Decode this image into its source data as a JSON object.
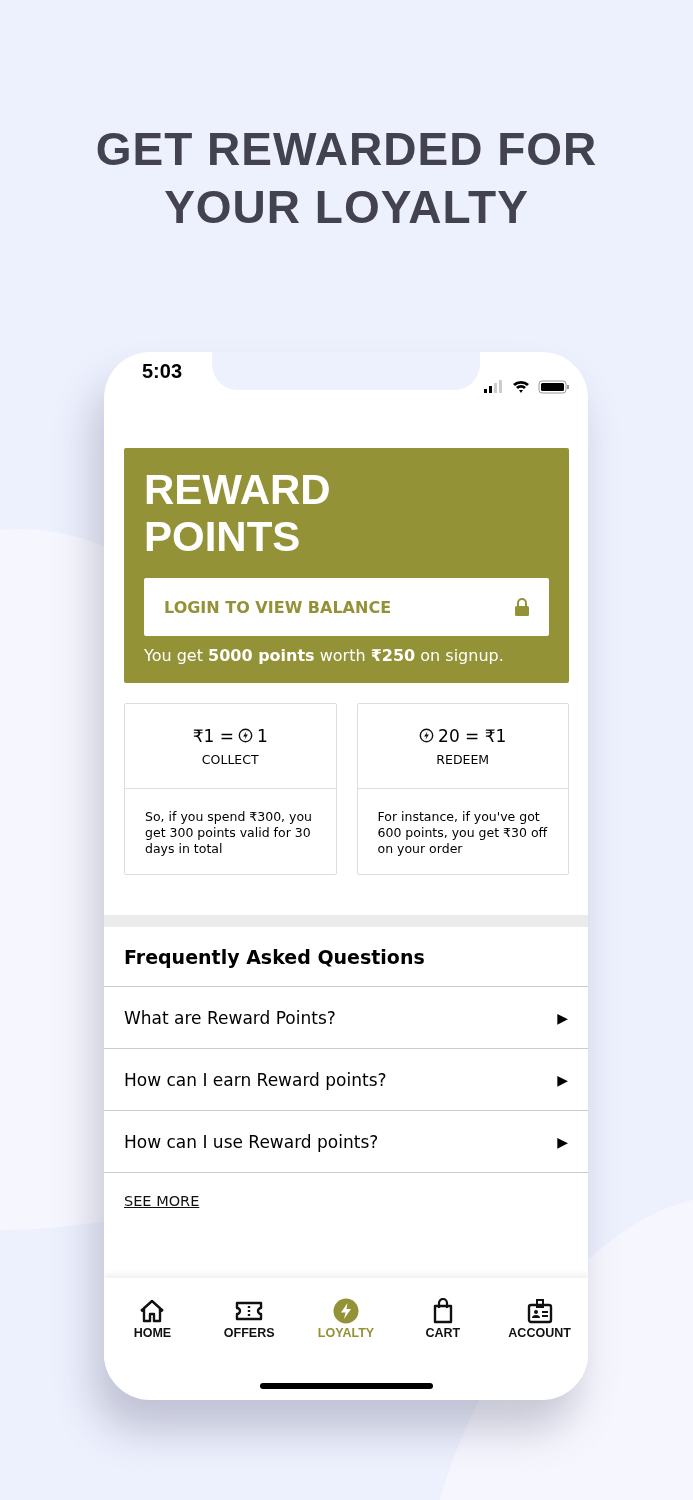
{
  "headline": "GET REWARDED FOR YOUR LOYALTY",
  "status_bar": {
    "time": "5:03"
  },
  "reward_card": {
    "title": "REWARD POINTS",
    "login_button": "LOGIN TO VIEW BALANCE",
    "signup_note": "You get **5000 points** worth **₹250** on signup."
  },
  "rate_cards": [
    {
      "before": "₹1 =",
      "after": "1",
      "label": "COLLECT",
      "description": "So, if you spend ₹300, you get 300 points valid for 30 days in total"
    },
    {
      "after": "20 = ₹1",
      "label": "REDEEM",
      "description": "For instance, if you've got 600 points, you get ₹30 off on your order"
    }
  ],
  "faq": {
    "title": "Frequently Asked Questions",
    "items": [
      {
        "question": "What are Reward Points?",
        "arrow": "▶"
      },
      {
        "question": "How can I earn Reward points?",
        "arrow": "▶"
      },
      {
        "question": "How can I use Reward points?",
        "arrow": "▶"
      }
    ],
    "see_more": "SEE MORE"
  },
  "nav": [
    {
      "label": "HOME",
      "kind": "home",
      "selected": false
    },
    {
      "label": "OFFERS",
      "kind": "offers",
      "selected": false
    },
    {
      "label": "LOYALTY",
      "kind": "loyalty",
      "selected": true
    },
    {
      "label": "CART",
      "kind": "cart",
      "selected": false
    },
    {
      "label": "ACCOUNT",
      "kind": "account",
      "selected": false
    }
  ]
}
